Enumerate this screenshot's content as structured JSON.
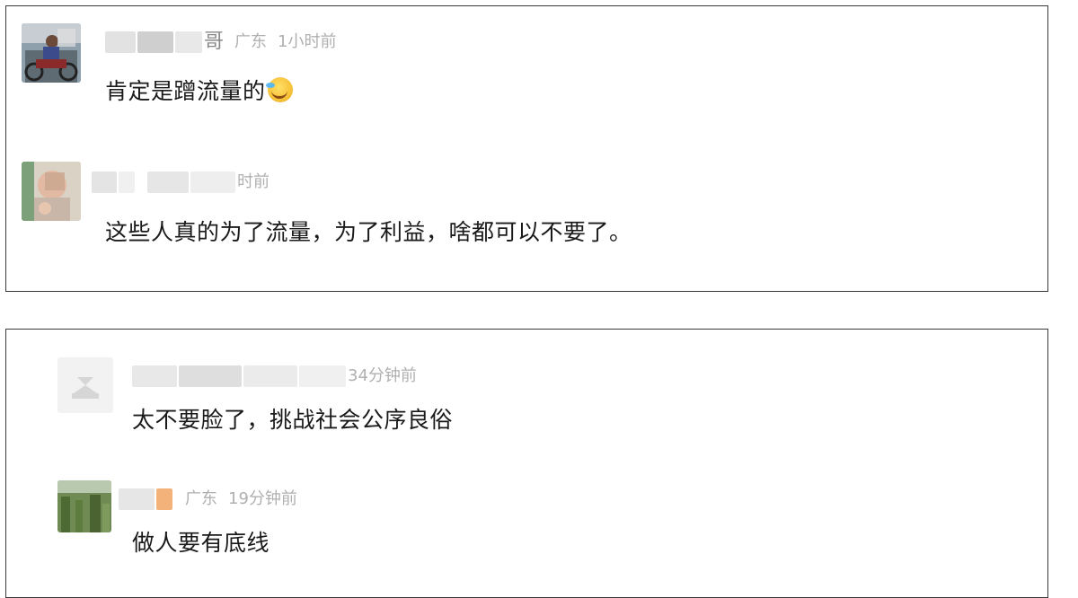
{
  "comments_top": [
    {
      "username_tail": "哥",
      "location": "广东",
      "time": "1小时前",
      "text": "肯定是蹭流量的",
      "emoji": "laughing-crying-emoji"
    },
    {
      "time_tail": "时前",
      "text": "这些人真的为了流量，为了利益，啥都可以不要了。"
    }
  ],
  "comments_bottom": [
    {
      "time_tail": "34分钟前",
      "text": "太不要脸了，挑战社会公序良俗",
      "avatar": "default-avatar-icon"
    },
    {
      "location": "广东",
      "time": "19分钟前",
      "text": "做人要有底线"
    }
  ],
  "colors": {
    "body_text": "#1a1a1a",
    "meta_text": "#b0b0b0",
    "border": "#3a3a3a"
  }
}
